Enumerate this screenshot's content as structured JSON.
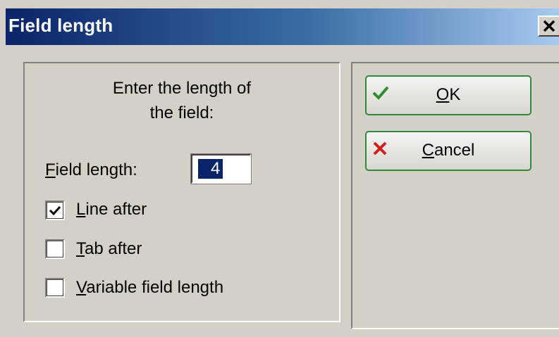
{
  "window": {
    "title": "Field length",
    "close_symbol": "×"
  },
  "prompt": {
    "line1": "Enter the length of",
    "line2": "the field:"
  },
  "field_length": {
    "label": "Field length:",
    "value": "4"
  },
  "options": [
    {
      "label": "Line after",
      "checked": true
    },
    {
      "label": "Tab after",
      "checked": false
    },
    {
      "label": "Variable field length",
      "checked": false
    }
  ],
  "buttons": {
    "ok": {
      "label": "OK",
      "icon": "check-icon"
    },
    "cancel": {
      "label": "Cancel",
      "icon": "x-icon"
    }
  },
  "colors": {
    "title_start": "#0a246a",
    "title_end": "#a6caf0",
    "ok_check": "#2e8b2e",
    "cancel_x": "#d22020"
  }
}
